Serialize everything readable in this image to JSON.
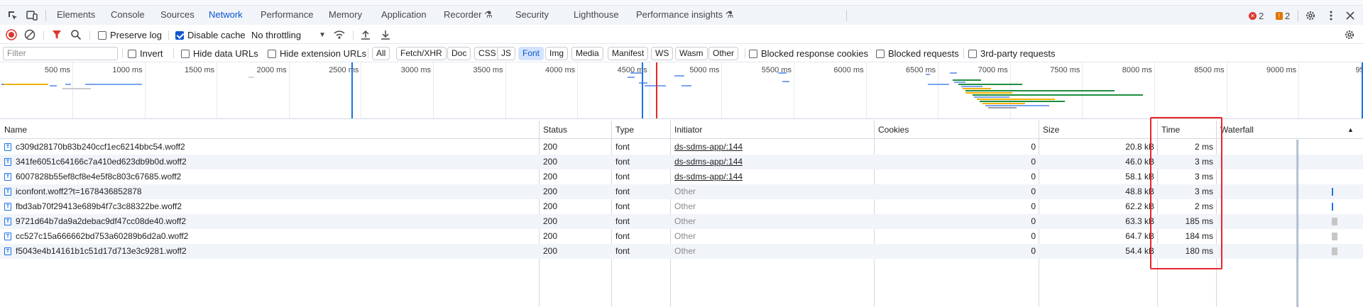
{
  "tabs": [
    {
      "label": "Elements",
      "active": false
    },
    {
      "label": "Console",
      "active": false
    },
    {
      "label": "Sources",
      "active": false
    },
    {
      "label": "Network",
      "active": true
    },
    {
      "label": "Performance",
      "active": false
    },
    {
      "label": "Memory",
      "active": false
    },
    {
      "label": "Application",
      "active": false
    },
    {
      "label": "Recorder ⚗",
      "active": false
    },
    {
      "label": "Security",
      "active": false
    },
    {
      "label": "Lighthouse",
      "active": false
    },
    {
      "label": "Performance insights ⚗",
      "active": false
    }
  ],
  "status": {
    "errors": "2",
    "warnings": "2"
  },
  "toolbar": {
    "preserve_log": "Preserve log",
    "disable_cache": "Disable cache",
    "throttling": "No throttling"
  },
  "filter": {
    "placeholder": "Filter",
    "invert": "Invert",
    "hide_data_urls": "Hide data URLs",
    "hide_extension_urls": "Hide extension URLs",
    "types": [
      "All",
      "Fetch/XHR",
      "Doc",
      "CSS",
      "JS",
      "Font",
      "Img",
      "Media",
      "Manifest",
      "WS",
      "Wasm",
      "Other"
    ],
    "active_type": "Font",
    "blocked_cookies": "Blocked response cookies",
    "blocked_requests": "Blocked requests",
    "third_party": "3rd-party requests"
  },
  "overview": {
    "ticks": [
      "500 ms",
      "1000 ms",
      "1500 ms",
      "2000 ms",
      "2500 ms",
      "3000 ms",
      "3500 ms",
      "4000 ms",
      "4500 ms",
      "5000 ms",
      "5500 ms",
      "6000 ms",
      "6500 ms",
      "7000 ms",
      "7500 ms",
      "8000 ms",
      "8500 ms",
      "9000 ms",
      "950"
    ]
  },
  "table": {
    "headers": {
      "name": "Name",
      "status": "Status",
      "type": "Type",
      "initiator": "Initiator",
      "cookies": "Cookies",
      "size": "Size",
      "time": "Time",
      "waterfall": "Waterfall"
    },
    "rows": [
      {
        "name": "c309d28170b83b240ccf1ec6214bbc54.woff2",
        "status": "200",
        "type": "font",
        "initiator": "ds-sdms-app/:144",
        "initiator_link": true,
        "cookies": "0",
        "size": "20.8 kB",
        "time": "2 ms"
      },
      {
        "name": "341fe6051c64166c7a410ed623db9b0d.woff2",
        "status": "200",
        "type": "font",
        "initiator": "ds-sdms-app/:144",
        "initiator_link": true,
        "cookies": "0",
        "size": "46.0 kB",
        "time": "3 ms"
      },
      {
        "name": "6007828b55ef8cf8e4e5f8c803c67685.woff2",
        "status": "200",
        "type": "font",
        "initiator": "ds-sdms-app/:144",
        "initiator_link": true,
        "cookies": "0",
        "size": "58.1 kB",
        "time": "3 ms"
      },
      {
        "name": "iconfont.woff2?t=1678436852878",
        "status": "200",
        "type": "font",
        "initiator": "Other",
        "initiator_link": false,
        "cookies": "0",
        "size": "48.8 kB",
        "time": "3 ms"
      },
      {
        "name": "fbd3ab70f29413e689b4f7c3c88322be.woff2",
        "status": "200",
        "type": "font",
        "initiator": "Other",
        "initiator_link": false,
        "cookies": "0",
        "size": "62.2 kB",
        "time": "2 ms"
      },
      {
        "name": "9721d64b7da9a2debac9df47cc08de40.woff2",
        "status": "200",
        "type": "font",
        "initiator": "Other",
        "initiator_link": false,
        "cookies": "0",
        "size": "63.3 kB",
        "time": "185 ms"
      },
      {
        "name": "cc527c15a666662bd753a60289b6d2a0.woff2",
        "status": "200",
        "type": "font",
        "initiator": "Other",
        "initiator_link": false,
        "cookies": "0",
        "size": "64.7 kB",
        "time": "184 ms"
      },
      {
        "name": "f5043e4b14161b1c51d17d713e3c9281.woff2",
        "status": "200",
        "type": "font",
        "initiator": "Other",
        "initiator_link": false,
        "cookies": "0",
        "size": "54.4 kB",
        "time": "180 ms"
      }
    ]
  },
  "colors": {
    "accent": "#0b57d0",
    "highlight": "#e8252b",
    "error": "#dc362e",
    "warning": "#e37400"
  }
}
